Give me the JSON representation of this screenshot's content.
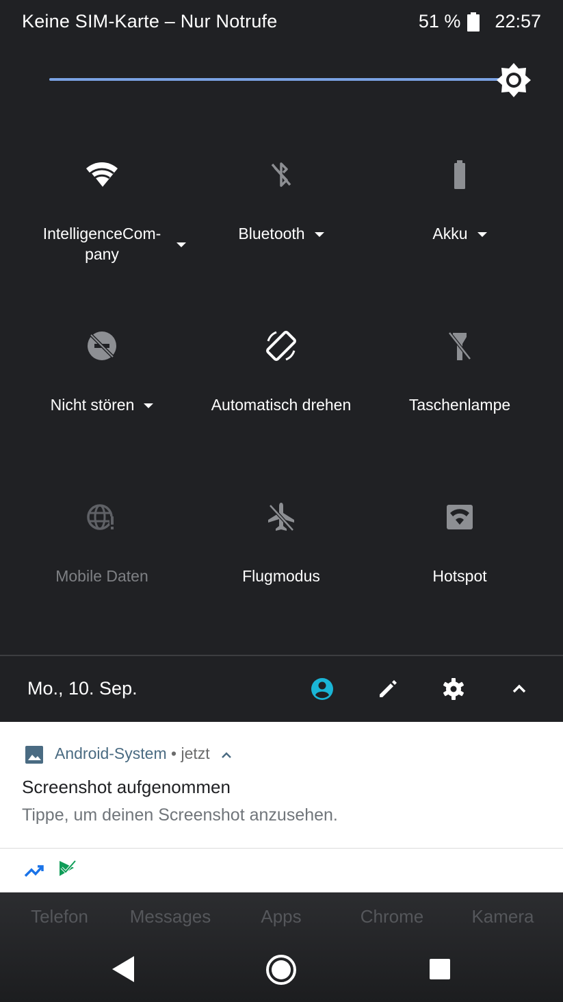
{
  "status_bar": {
    "carrier": "Keine SIM-Karte – Nur Notrufe",
    "battery": "51 %",
    "time": "22:57",
    "battery_icon": "battery-icon"
  },
  "brightness": {
    "icon": "brightness-icon",
    "level": 1.0
  },
  "tiles": [
    {
      "label": "IntelligenceCom-",
      "label2": "pany",
      "icon": "wifi-icon",
      "has_dropdown": true
    },
    {
      "label": "Bluetooth",
      "icon": "bluetooth-off-icon",
      "has_dropdown": true
    },
    {
      "label": "Akku",
      "icon": "battery-saver-icon",
      "has_dropdown": true
    },
    {
      "label": "Nicht stören",
      "icon": "do-not-disturb-icon",
      "has_dropdown": true
    },
    {
      "label": "Automatisch drehen",
      "icon": "auto-rotate-icon",
      "has_dropdown": false
    },
    {
      "label": "Taschenlampe",
      "icon": "flashlight-icon",
      "has_dropdown": false
    },
    {
      "label": "Mobile Daten",
      "icon": "mobile-data-icon",
      "has_dropdown": false
    },
    {
      "label": "Flugmodus",
      "icon": "airplane-mode-icon",
      "has_dropdown": false
    },
    {
      "label": "Hotspot",
      "icon": "hotspot-icon",
      "has_dropdown": false
    }
  ],
  "footer": {
    "date": "Mo., 10. Sep.",
    "icons": [
      "user-icon",
      "edit-icon",
      "settings-icon",
      "collapse-icon"
    ],
    "user_color": "#1ab5d6"
  },
  "notification": {
    "app_name": "Android-System",
    "separator": " • ",
    "time": "jetzt",
    "title": "Screenshot aufgenommen",
    "text": "Tippe, um deinen Screenshot anzusehen.",
    "icons": [
      "trending-icon",
      "checkmark-flag-icon"
    ],
    "accent": "#4a6b82"
  },
  "dock": {
    "apps": [
      "Telefon",
      "Messages",
      "Apps",
      "Chrome",
      "Kamera"
    ]
  },
  "navigation": {
    "buttons": [
      "back-icon",
      "home-icon",
      "recents-icon"
    ]
  }
}
